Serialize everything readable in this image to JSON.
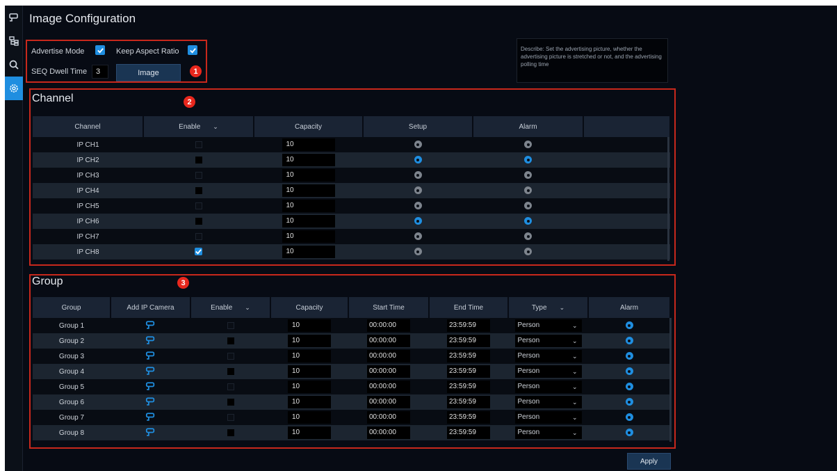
{
  "caption": "Image Configuration",
  "page_title": "Image Configuration",
  "sidebar": [
    {
      "icon": "camera-icon",
      "active": false
    },
    {
      "icon": "network-tree-icon",
      "active": false
    },
    {
      "icon": "search-icon",
      "active": false
    },
    {
      "icon": "settings-icon",
      "active": true
    }
  ],
  "top": {
    "advertise_mode_label": "Advertise Mode",
    "advertise_mode_checked": true,
    "keep_aspect_label": "Keep Aspect Ratio",
    "keep_aspect_checked": true,
    "seq_label": "SEQ Dwell Time",
    "seq_value": "3",
    "image_button": "Image",
    "badge": "1"
  },
  "describe": "Describe: Set the advertising picture, whether the advertising picture is stretched or not, and the advertising polling time",
  "channel": {
    "title": "Channel",
    "badge": "2",
    "headers": [
      "Channel",
      "Enable",
      "Capacity",
      "Setup",
      "Alarm",
      ""
    ],
    "rows": [
      {
        "name": "IP CH1",
        "enable": "off",
        "capacity": "10",
        "setup": "grey",
        "alarm": "grey"
      },
      {
        "name": "IP CH2",
        "enable": "dark",
        "capacity": "10",
        "setup": "blue",
        "alarm": "blue"
      },
      {
        "name": "IP CH3",
        "enable": "off",
        "capacity": "10",
        "setup": "grey",
        "alarm": "grey"
      },
      {
        "name": "IP CH4",
        "enable": "dark",
        "capacity": "10",
        "setup": "grey",
        "alarm": "grey"
      },
      {
        "name": "IP CH5",
        "enable": "off",
        "capacity": "10",
        "setup": "grey",
        "alarm": "grey"
      },
      {
        "name": "IP CH6",
        "enable": "dark",
        "capacity": "10",
        "setup": "blue",
        "alarm": "blue"
      },
      {
        "name": "IP CH7",
        "enable": "off",
        "capacity": "10",
        "setup": "grey",
        "alarm": "grey"
      },
      {
        "name": "IP CH8",
        "enable": "on",
        "capacity": "10",
        "setup": "grey",
        "alarm": "grey"
      }
    ]
  },
  "group": {
    "title": "Group",
    "badge": "3",
    "headers": [
      "Group",
      "Add IP Camera",
      "Enable",
      "Capacity",
      "Start Time",
      "End Time",
      "Type",
      "Alarm"
    ],
    "rows": [
      {
        "name": "Group 1",
        "enable": "off",
        "capacity": "10",
        "start": "00:00:00",
        "end": "23:59:59",
        "type": "Person"
      },
      {
        "name": "Group 2",
        "enable": "dark",
        "capacity": "10",
        "start": "00:00:00",
        "end": "23:59:59",
        "type": "Person"
      },
      {
        "name": "Group 3",
        "enable": "off",
        "capacity": "10",
        "start": "00:00:00",
        "end": "23:59:59",
        "type": "Person"
      },
      {
        "name": "Group 4",
        "enable": "dark",
        "capacity": "10",
        "start": "00:00:00",
        "end": "23:59:59",
        "type": "Person"
      },
      {
        "name": "Group 5",
        "enable": "off",
        "capacity": "10",
        "start": "00:00:00",
        "end": "23:59:59",
        "type": "Person"
      },
      {
        "name": "Group 6",
        "enable": "dark",
        "capacity": "10",
        "start": "00:00:00",
        "end": "23:59:59",
        "type": "Person"
      },
      {
        "name": "Group 7",
        "enable": "off",
        "capacity": "10",
        "start": "00:00:00",
        "end": "23:59:59",
        "type": "Person"
      },
      {
        "name": "Group 8",
        "enable": "dark",
        "capacity": "10",
        "start": "00:00:00",
        "end": "23:59:59",
        "type": "Person"
      }
    ]
  },
  "apply_button": "Apply",
  "colors": {
    "accent": "#1f8ee0",
    "highlight_border": "#c8281c",
    "badge": "#e8271d"
  }
}
